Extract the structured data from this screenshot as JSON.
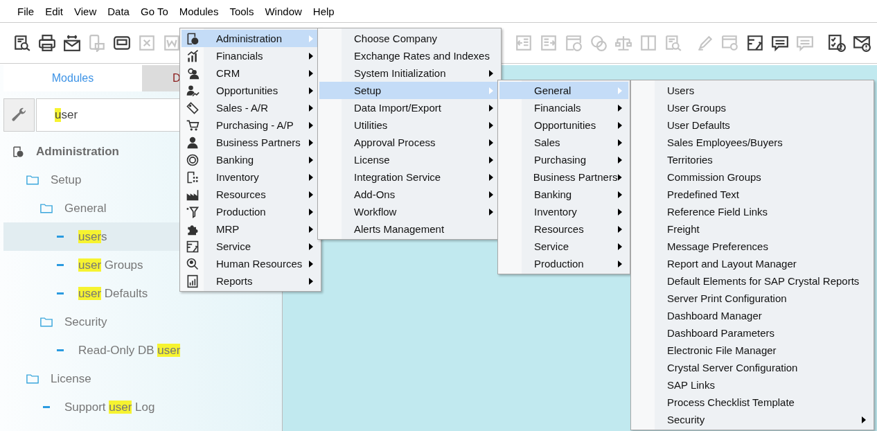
{
  "menu_bar": [
    "File",
    "Edit",
    "View",
    "Data",
    "Go To",
    "Modules",
    "Tools",
    "Window",
    "Help"
  ],
  "toolbar": {
    "left_groups": [
      [
        {
          "kind": "search-doc",
          "disabled": false
        },
        {
          "kind": "printer",
          "disabled": false
        },
        {
          "kind": "mail",
          "disabled": false
        },
        {
          "kind": "phone-chat",
          "disabled": true
        },
        {
          "kind": "window",
          "disabled": false
        },
        {
          "kind": "spreadsheet",
          "disabled": true
        },
        {
          "kind": "document",
          "disabled": true
        }
      ]
    ],
    "right_groups": [
      [
        {
          "kind": "arrow-left-doc",
          "disabled": true
        },
        {
          "kind": "arrow-right-doc",
          "disabled": true
        },
        {
          "kind": "coin-doc",
          "disabled": true
        },
        {
          "kind": "coins",
          "disabled": true
        },
        {
          "kind": "scale",
          "disabled": true
        },
        {
          "kind": "ledger",
          "disabled": true
        },
        {
          "kind": "search-doc",
          "disabled": true
        }
      ],
      [
        {
          "kind": "pencil",
          "disabled": true
        },
        {
          "kind": "gear-window",
          "disabled": true
        },
        {
          "kind": "wrench-doc",
          "disabled": false
        },
        {
          "kind": "chat",
          "disabled": false
        },
        {
          "kind": "chat",
          "disabled": true
        }
      ],
      [
        {
          "kind": "check-alert",
          "disabled": false
        },
        {
          "kind": "mail-alert",
          "disabled": false
        }
      ]
    ]
  },
  "side_panel": {
    "tabs": [
      {
        "label": "Modules",
        "selected": true
      },
      {
        "label": "D",
        "selected": false
      }
    ],
    "search": {
      "match": "u",
      "after": "ser"
    },
    "tree": [
      {
        "kind": "module",
        "label": "Administration",
        "selected": false,
        "children": [
          {
            "kind": "folder",
            "label": "Setup",
            "selected": false,
            "children": [
              {
                "kind": "folder",
                "label": "General",
                "selected": false,
                "children": [
                  {
                    "kind": "item",
                    "match": "user",
                    "after": "s",
                    "selected": true
                  },
                  {
                    "kind": "item",
                    "match": "user",
                    "after": " Groups",
                    "selected": false
                  },
                  {
                    "kind": "item",
                    "match": "user",
                    "after": " Defaults",
                    "selected": false
                  }
                ]
              },
              {
                "kind": "folder",
                "label": "Security",
                "selected": false,
                "children": [
                  {
                    "kind": "item",
                    "before": "Read-Only DB ",
                    "match": "user",
                    "selected": false
                  }
                ]
              }
            ]
          },
          {
            "kind": "folder",
            "label": "License",
            "selected": false,
            "children": [
              {
                "kind": "item",
                "before": "Support ",
                "match": "user",
                "after": " Log",
                "selected": false
              }
            ]
          }
        ]
      }
    ]
  },
  "menus": [
    {
      "items": [
        {
          "label": "Administration",
          "kind": "gear-doc",
          "has_submenu": true,
          "selected": true
        },
        {
          "label": "Financials",
          "kind": "chart",
          "has_submenu": true,
          "selected": false
        },
        {
          "label": "CRM",
          "kind": "people",
          "has_submenu": true,
          "selected": false
        },
        {
          "label": "Opportunities",
          "kind": "person-chart",
          "has_submenu": true,
          "selected": false
        },
        {
          "label": "Sales - A/R",
          "kind": "tag",
          "has_submenu": true,
          "selected": false
        },
        {
          "label": "Purchasing - A/P",
          "kind": "cart",
          "has_submenu": true,
          "selected": false
        },
        {
          "label": "Business Partners",
          "kind": "person",
          "has_submenu": true,
          "selected": false
        },
        {
          "label": "Banking",
          "kind": "coin",
          "has_submenu": true,
          "selected": false
        },
        {
          "label": "Inventory",
          "kind": "doc-grid",
          "has_submenu": true,
          "selected": false
        },
        {
          "label": "Resources",
          "kind": "factory",
          "has_submenu": true,
          "selected": false
        },
        {
          "label": "Production",
          "kind": "funnel",
          "has_submenu": true,
          "selected": false
        },
        {
          "label": "MRP",
          "kind": "puzzle",
          "has_submenu": true,
          "selected": false
        },
        {
          "label": "Service",
          "kind": "wrench-doc",
          "has_submenu": true,
          "selected": false
        },
        {
          "label": "Human Resources",
          "kind": "magnifier",
          "has_submenu": true,
          "selected": false
        },
        {
          "label": "Reports",
          "kind": "report",
          "has_submenu": true,
          "selected": false
        }
      ]
    },
    {
      "items": [
        {
          "label": "Choose Company",
          "has_submenu": false,
          "selected": false
        },
        {
          "label": "Exchange Rates and Indexes",
          "has_submenu": false,
          "selected": false
        },
        {
          "label": "System Initialization",
          "has_submenu": true,
          "selected": false
        },
        {
          "label": "Setup",
          "has_submenu": true,
          "selected": true
        },
        {
          "label": "Data Import/Export",
          "has_submenu": true,
          "selected": false
        },
        {
          "label": "Utilities",
          "has_submenu": true,
          "selected": false
        },
        {
          "label": "Approval Process",
          "has_submenu": true,
          "selected": false
        },
        {
          "label": "License",
          "has_submenu": true,
          "selected": false
        },
        {
          "label": "Integration Service",
          "has_submenu": true,
          "selected": false
        },
        {
          "label": "Add-Ons",
          "has_submenu": true,
          "selected": false
        },
        {
          "label": "Workflow",
          "has_submenu": true,
          "selected": false
        },
        {
          "label": "Alerts Management",
          "has_submenu": false,
          "selected": false
        }
      ]
    },
    {
      "items": [
        {
          "label": "General",
          "has_submenu": true,
          "selected": true
        },
        {
          "label": "Financials",
          "has_submenu": true,
          "selected": false
        },
        {
          "label": "Opportunities",
          "has_submenu": true,
          "selected": false
        },
        {
          "label": "Sales",
          "has_submenu": true,
          "selected": false
        },
        {
          "label": "Purchasing",
          "has_submenu": true,
          "selected": false
        },
        {
          "label": "Business Partners",
          "has_submenu": true,
          "selected": false
        },
        {
          "label": "Banking",
          "has_submenu": true,
          "selected": false
        },
        {
          "label": "Inventory",
          "has_submenu": true,
          "selected": false
        },
        {
          "label": "Resources",
          "has_submenu": true,
          "selected": false
        },
        {
          "label": "Service",
          "has_submenu": true,
          "selected": false
        },
        {
          "label": "Production",
          "has_submenu": true,
          "selected": false
        }
      ]
    },
    {
      "items": [
        {
          "label": "Users",
          "has_submenu": false,
          "selected": false
        },
        {
          "label": "User Groups",
          "has_submenu": false,
          "selected": false
        },
        {
          "label": "User Defaults",
          "has_submenu": false,
          "selected": false
        },
        {
          "label": "Sales Employees/Buyers",
          "has_submenu": false,
          "selected": false
        },
        {
          "label": "Territories",
          "has_submenu": false,
          "selected": false
        },
        {
          "label": "Commission Groups",
          "has_submenu": false,
          "selected": false
        },
        {
          "label": "Predefined Text",
          "has_submenu": false,
          "selected": false
        },
        {
          "label": "Reference Field Links",
          "has_submenu": false,
          "selected": false
        },
        {
          "label": "Freight",
          "has_submenu": false,
          "selected": false
        },
        {
          "label": "Message Preferences",
          "has_submenu": false,
          "selected": false
        },
        {
          "label": "Report and Layout Manager",
          "has_submenu": false,
          "selected": false
        },
        {
          "label": "Default Elements for SAP Crystal Reports",
          "has_submenu": false,
          "selected": false
        },
        {
          "label": "Server Print Configuration",
          "has_submenu": false,
          "selected": false
        },
        {
          "label": "Dashboard Manager",
          "has_submenu": false,
          "selected": false
        },
        {
          "label": "Dashboard Parameters",
          "has_submenu": false,
          "selected": false
        },
        {
          "label": "Electronic File Manager",
          "has_submenu": false,
          "selected": false
        },
        {
          "label": "Crystal Server Configuration",
          "has_submenu": false,
          "selected": false
        },
        {
          "label": "SAP Links",
          "has_submenu": false,
          "selected": false
        },
        {
          "label": "Process Checklist Template",
          "has_submenu": false,
          "selected": false
        },
        {
          "label": "Security",
          "has_submenu": true,
          "selected": false
        }
      ]
    }
  ]
}
